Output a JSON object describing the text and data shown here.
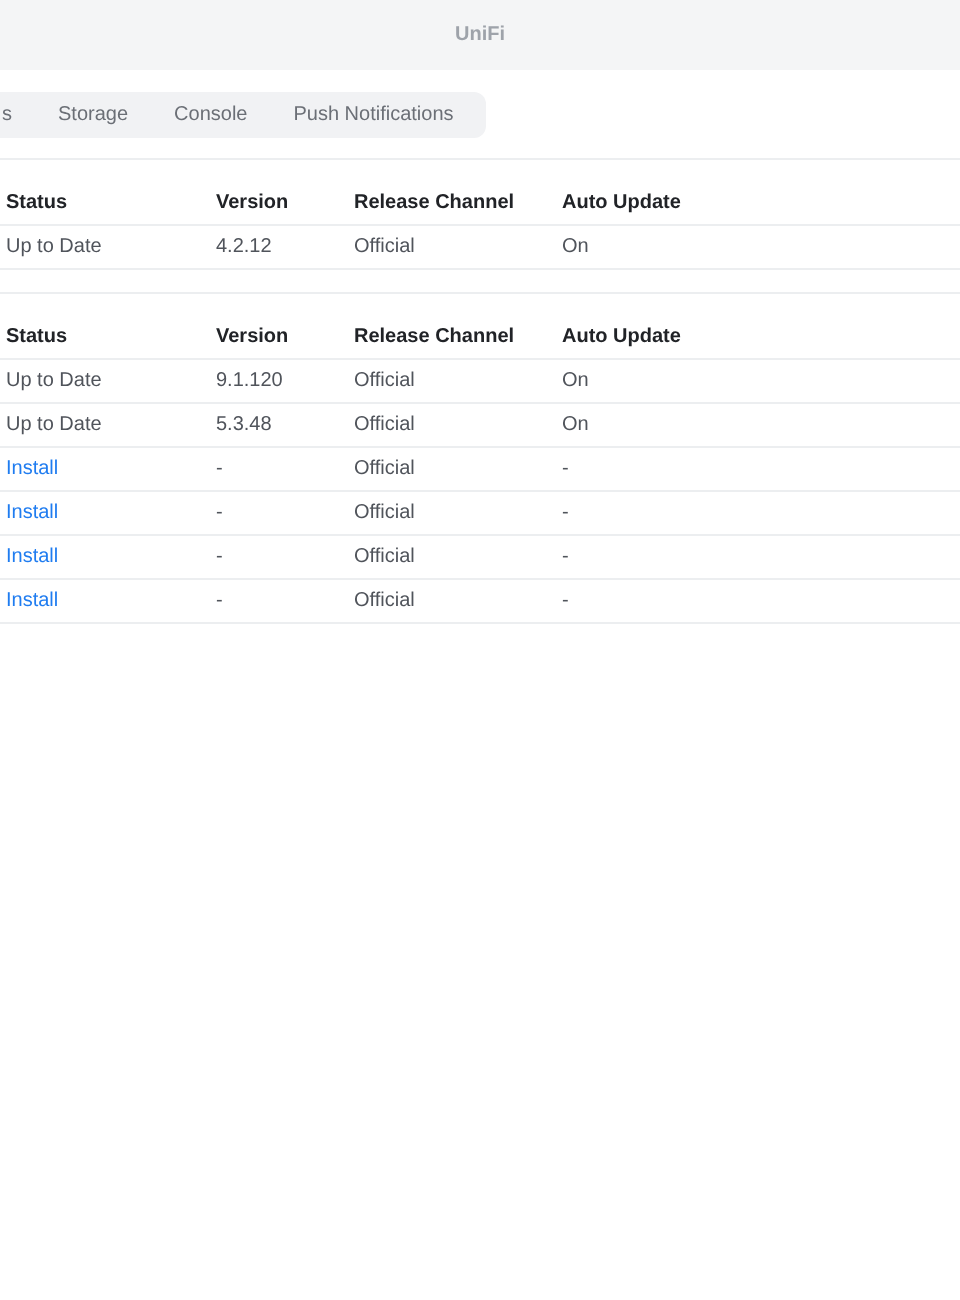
{
  "window": {
    "title": "UniFi"
  },
  "tabs": [
    {
      "label": "s",
      "selected": false
    },
    {
      "label": "Storage",
      "selected": false
    },
    {
      "label": "Console",
      "selected": false
    },
    {
      "label": "Push Notifications",
      "selected": false
    }
  ],
  "tables": [
    {
      "columns": [
        "Status",
        "Version",
        "Release Channel",
        "Auto Update"
      ],
      "rows": [
        {
          "status": {
            "text": "Up to Date",
            "kind": "text"
          },
          "version": "4.2.12",
          "channel": "Official",
          "auto_update": "On"
        }
      ]
    },
    {
      "columns": [
        "Status",
        "Version",
        "Release Channel",
        "Auto Update"
      ],
      "rows": [
        {
          "status": {
            "text": "Up to Date",
            "kind": "text"
          },
          "version": "9.1.120",
          "channel": "Official",
          "auto_update": "On"
        },
        {
          "status": {
            "text": "Up to Date",
            "kind": "text"
          },
          "version": "5.3.48",
          "channel": "Official",
          "auto_update": "On"
        },
        {
          "status": {
            "text": "Install",
            "kind": "link"
          },
          "version": "-",
          "channel": "Official",
          "auto_update": "-"
        },
        {
          "status": {
            "text": "Install",
            "kind": "link"
          },
          "version": "-",
          "channel": "Official",
          "auto_update": "-"
        },
        {
          "status": {
            "text": "Install",
            "kind": "link"
          },
          "version": "-",
          "channel": "Official",
          "auto_update": "-"
        },
        {
          "status": {
            "text": "Install",
            "kind": "link"
          },
          "version": "-",
          "channel": "Official",
          "auto_update": "-"
        }
      ]
    }
  ]
}
